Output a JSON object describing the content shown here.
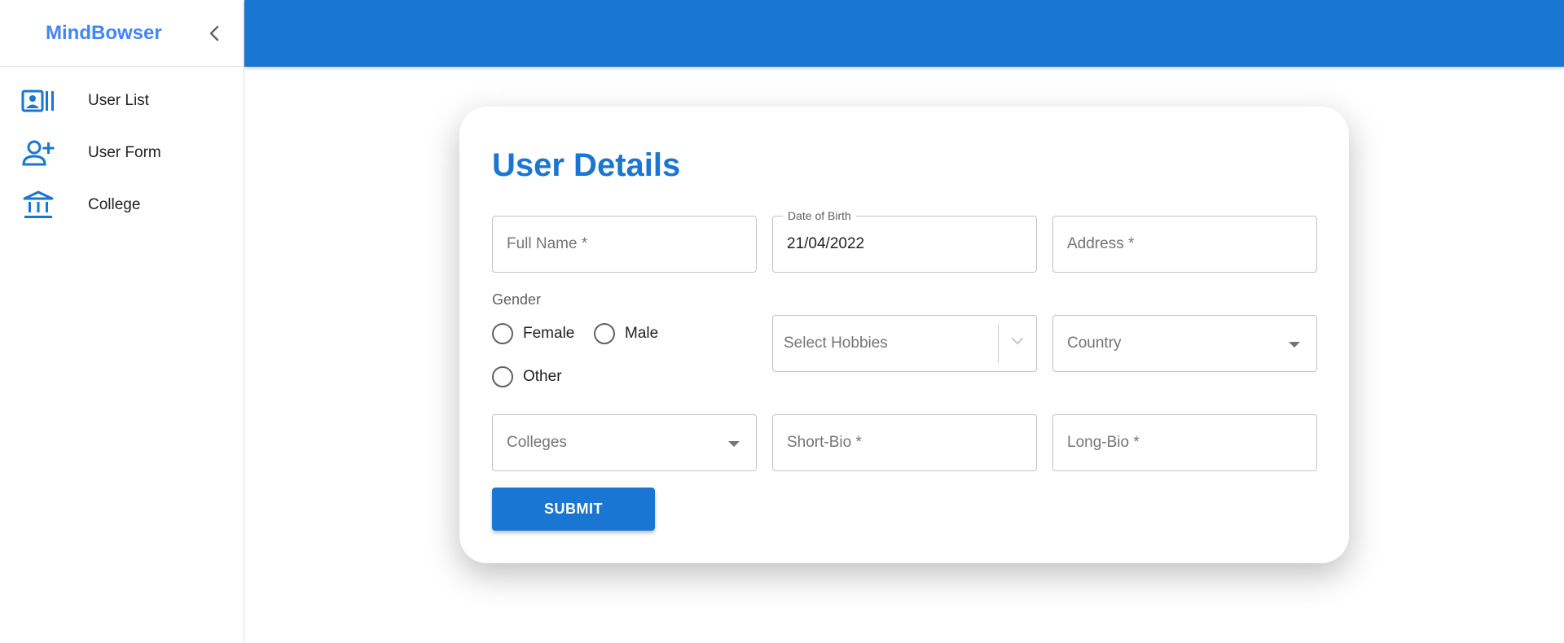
{
  "sidebar": {
    "brand": "MindBowser",
    "collapse_icon": "chevron-left-icon",
    "items": [
      {
        "label": "User List",
        "icon": "contact-list-icon"
      },
      {
        "label": "User Form",
        "icon": "person-add-icon"
      },
      {
        "label": "College",
        "icon": "institution-icon"
      }
    ]
  },
  "colors": {
    "primary": "#1976d2",
    "brand": "#4285f4"
  },
  "form": {
    "title": "User Details",
    "full_name": {
      "placeholder": "Full Name *"
    },
    "dob": {
      "label": "Date of Birth",
      "value": "21/04/2022"
    },
    "address": {
      "placeholder": "Address *"
    },
    "gender": {
      "label": "Gender",
      "options": [
        "Female",
        "Male",
        "Other"
      ]
    },
    "hobbies": {
      "placeholder": "Select Hobbies"
    },
    "country": {
      "placeholder": "Country"
    },
    "colleges": {
      "placeholder": "Colleges"
    },
    "short_bio": {
      "placeholder": "Short-Bio *"
    },
    "long_bio": {
      "placeholder": "Long-Bio *"
    },
    "submit_label": "SUBMIT"
  }
}
